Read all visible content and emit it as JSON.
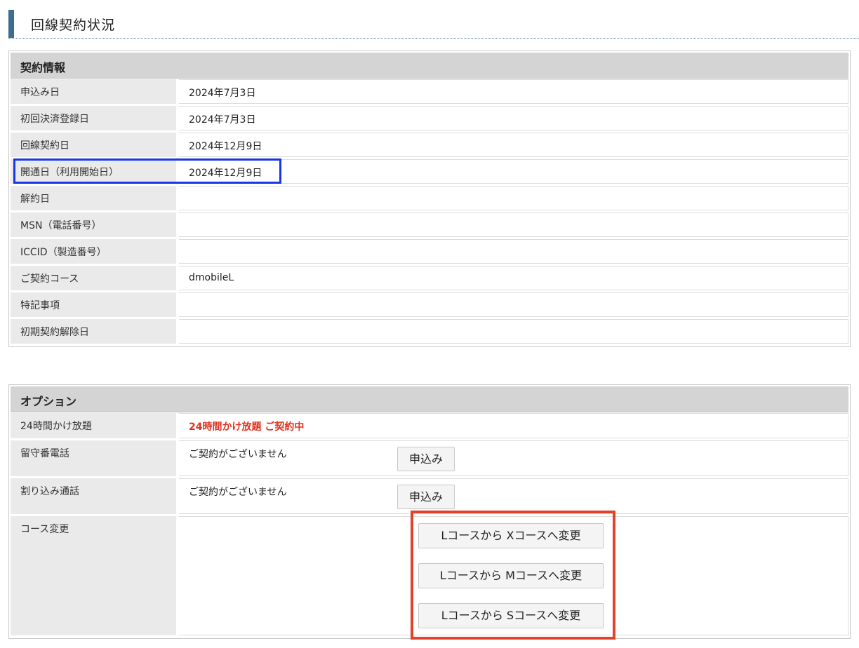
{
  "page": {
    "title": "回線契約状況"
  },
  "contract": {
    "heading": "契約情報",
    "rows": [
      {
        "label": "申込み日",
        "value": "2024年7月3日"
      },
      {
        "label": "初回決済登録日",
        "value": "2024年7月3日"
      },
      {
        "label": "回線契約日",
        "value": "2024年12月9日"
      },
      {
        "label": "開通日（利用開始日）",
        "value": "2024年12月9日"
      },
      {
        "label": "解約日",
        "value": ""
      },
      {
        "label": "MSN（電話番号）",
        "value": ""
      },
      {
        "label": "ICCID（製造番号）",
        "value": ""
      },
      {
        "label": "ご契約コース",
        "value": "dmobileL"
      },
      {
        "label": "特記事項",
        "value": ""
      },
      {
        "label": "初期契約解除日",
        "value": ""
      }
    ]
  },
  "option": {
    "heading": "オプション",
    "rows": [
      {
        "label": "24時間かけ放題",
        "value": "24時間かけ放題 ご契約中",
        "value_color": "#e0321f"
      },
      {
        "label": "留守番電話",
        "value": "ご契約がございません",
        "button": "申込み"
      },
      {
        "label": "割り込み通話",
        "value": "ご契約がございません",
        "button": "申込み"
      },
      {
        "label": "コース変更",
        "buttons": [
          "Lコースから Xコースへ変更",
          "Lコースから Mコースへ変更",
          "Lコースから Sコースへ変更"
        ]
      }
    ]
  },
  "colors": {
    "header_bar": "#3d6e8c",
    "highlight_blue": "#1537e6",
    "highlight_red": "#e0432a",
    "status_red": "#e0321f"
  }
}
